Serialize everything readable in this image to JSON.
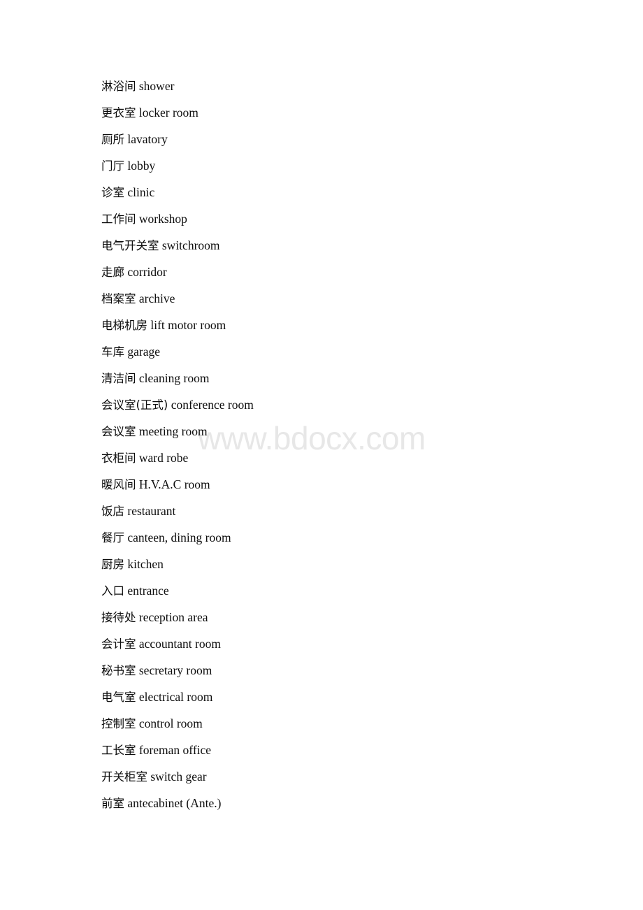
{
  "page": {
    "background_color": "#ffffff",
    "text_color": "#0d0d0d"
  },
  "watermark": {
    "text": "www.bdocx.com",
    "color": "#e7e7e7"
  },
  "glossary": {
    "entries": [
      {
        "zh": "淋浴间",
        "en": "shower"
      },
      {
        "zh": "更衣室",
        "en": "locker room"
      },
      {
        "zh": "厕所",
        "en": "lavatory"
      },
      {
        "zh": "门厅",
        "en": "lobby"
      },
      {
        "zh": "诊室",
        "en": "clinic"
      },
      {
        "zh": "工作间",
        "en": "workshop"
      },
      {
        "zh": "电气开关室",
        "en": "switchroom"
      },
      {
        "zh": "走廊",
        "en": "corridor"
      },
      {
        "zh": "档案室",
        "en": "archive"
      },
      {
        "zh": "电梯机房",
        "en": "lift motor room"
      },
      {
        "zh": "车库",
        "en": "garage"
      },
      {
        "zh": "清洁间",
        "en": "cleaning room"
      },
      {
        "zh": "会议室(正式)",
        "en": "conference room"
      },
      {
        "zh": "会议室",
        "en": "meeting room"
      },
      {
        "zh": "衣柜间",
        "en": "ward robe"
      },
      {
        "zh": "暖风间",
        "en": "H.V.A.C room"
      },
      {
        "zh": "饭店",
        "en": "restaurant"
      },
      {
        "zh": "餐厅",
        "en": "canteen, dining room"
      },
      {
        "zh": "厨房",
        "en": "kitchen"
      },
      {
        "zh": "入口",
        "en": "entrance"
      },
      {
        "zh": "接待处",
        "en": "reception area"
      },
      {
        "zh": "会计室",
        "en": "accountant room"
      },
      {
        "zh": "秘书室",
        "en": "secretary room"
      },
      {
        "zh": "电气室",
        "en": "electrical room"
      },
      {
        "zh": "控制室",
        "en": "control room"
      },
      {
        "zh": "工长室",
        "en": "foreman office"
      },
      {
        "zh": "开关柜室",
        "en": "switch gear"
      },
      {
        "zh": "前室",
        "en": "antecabinet (Ante.)"
      }
    ]
  }
}
